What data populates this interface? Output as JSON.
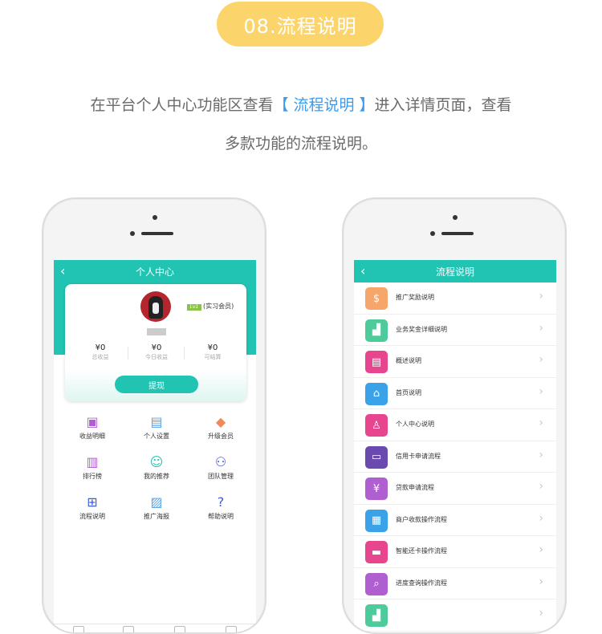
{
  "header": {
    "pill_label": "08.流程说明",
    "desc_pre": "在平台个人中心功能区查看",
    "desc_hl": "【 流程说明 】",
    "desc_post": "进入详情页面，查看",
    "desc_line2": "多款功能的流程说明。"
  },
  "colors": {
    "accent": "#21c3b3",
    "pill": "#fbd56b",
    "highlight": "#3a9bf0"
  },
  "phone1": {
    "title": "个人中心",
    "back_icon": "chevron-left-icon",
    "rank": "(实习会员)",
    "level_badge": "Lv1",
    "stats": [
      {
        "value": "¥0",
        "label": "总收益"
      },
      {
        "value": "¥0",
        "label": "今日收益"
      },
      {
        "value": "¥0",
        "label": "可结算"
      }
    ],
    "withdraw_label": "提现",
    "grid": [
      {
        "label": "收益明细",
        "icon": "income-detail-icon",
        "glyph": "▣",
        "color": "#b05fd0"
      },
      {
        "label": "个人设置",
        "icon": "profile-settings-icon",
        "glyph": "▤",
        "color": "#5aa0e8"
      },
      {
        "label": "升级会员",
        "icon": "diamond-icon",
        "glyph": "◆",
        "color": "#f08a5a"
      },
      {
        "label": "排行榜",
        "icon": "ranking-icon",
        "glyph": "▥",
        "color": "#b05fd0"
      },
      {
        "label": "我的推荐",
        "icon": "referral-icon",
        "glyph": "☺",
        "color": "#21c3b3"
      },
      {
        "label": "团队管理",
        "icon": "team-icon",
        "glyph": "⚇",
        "color": "#3b5bdb"
      },
      {
        "label": "流程说明",
        "icon": "flow-icon",
        "glyph": "⊞",
        "color": "#3b5bdb"
      },
      {
        "label": "推广海报",
        "icon": "poster-icon",
        "glyph": "▨",
        "color": "#5aa0e8"
      },
      {
        "label": "帮助说明",
        "icon": "help-icon",
        "glyph": "?",
        "color": "#3b5bdb"
      }
    ]
  },
  "phone2": {
    "title": "流程说明",
    "back_icon": "chevron-left-icon",
    "items": [
      {
        "label": "推广奖励说明",
        "icon": "reward-icon",
        "glyph": "$",
        "color": "#f7a66b"
      },
      {
        "label": "业务奖金详细说明",
        "icon": "bonus-chart-icon",
        "glyph": "▟",
        "color": "#4ecb9a"
      },
      {
        "label": "概述说明",
        "icon": "overview-doc-icon",
        "glyph": "▤",
        "color": "#e8458f"
      },
      {
        "label": "首页说明",
        "icon": "home-icon",
        "glyph": "⌂",
        "color": "#3aa2e8"
      },
      {
        "label": "个人中心说明",
        "icon": "user-icon",
        "glyph": "♙",
        "color": "#e8458f"
      },
      {
        "label": "信用卡申请流程",
        "icon": "wallet-icon",
        "glyph": "▭",
        "color": "#6b4ab0"
      },
      {
        "label": "贷款申请流程",
        "icon": "loan-icon",
        "glyph": "¥",
        "color": "#b05fd0"
      },
      {
        "label": "商户收款操作流程",
        "icon": "merchant-icon",
        "glyph": "▦",
        "color": "#3aa2e8"
      },
      {
        "label": "智能还卡操作流程",
        "icon": "card-icon",
        "glyph": "▬",
        "color": "#e8458f"
      },
      {
        "label": "进度查询操作流程",
        "icon": "search-doc-icon",
        "glyph": "⌕",
        "color": "#b05fd0"
      },
      {
        "label": "",
        "icon": "chart-icon",
        "glyph": "▟",
        "color": "#4ecb9a"
      }
    ]
  }
}
